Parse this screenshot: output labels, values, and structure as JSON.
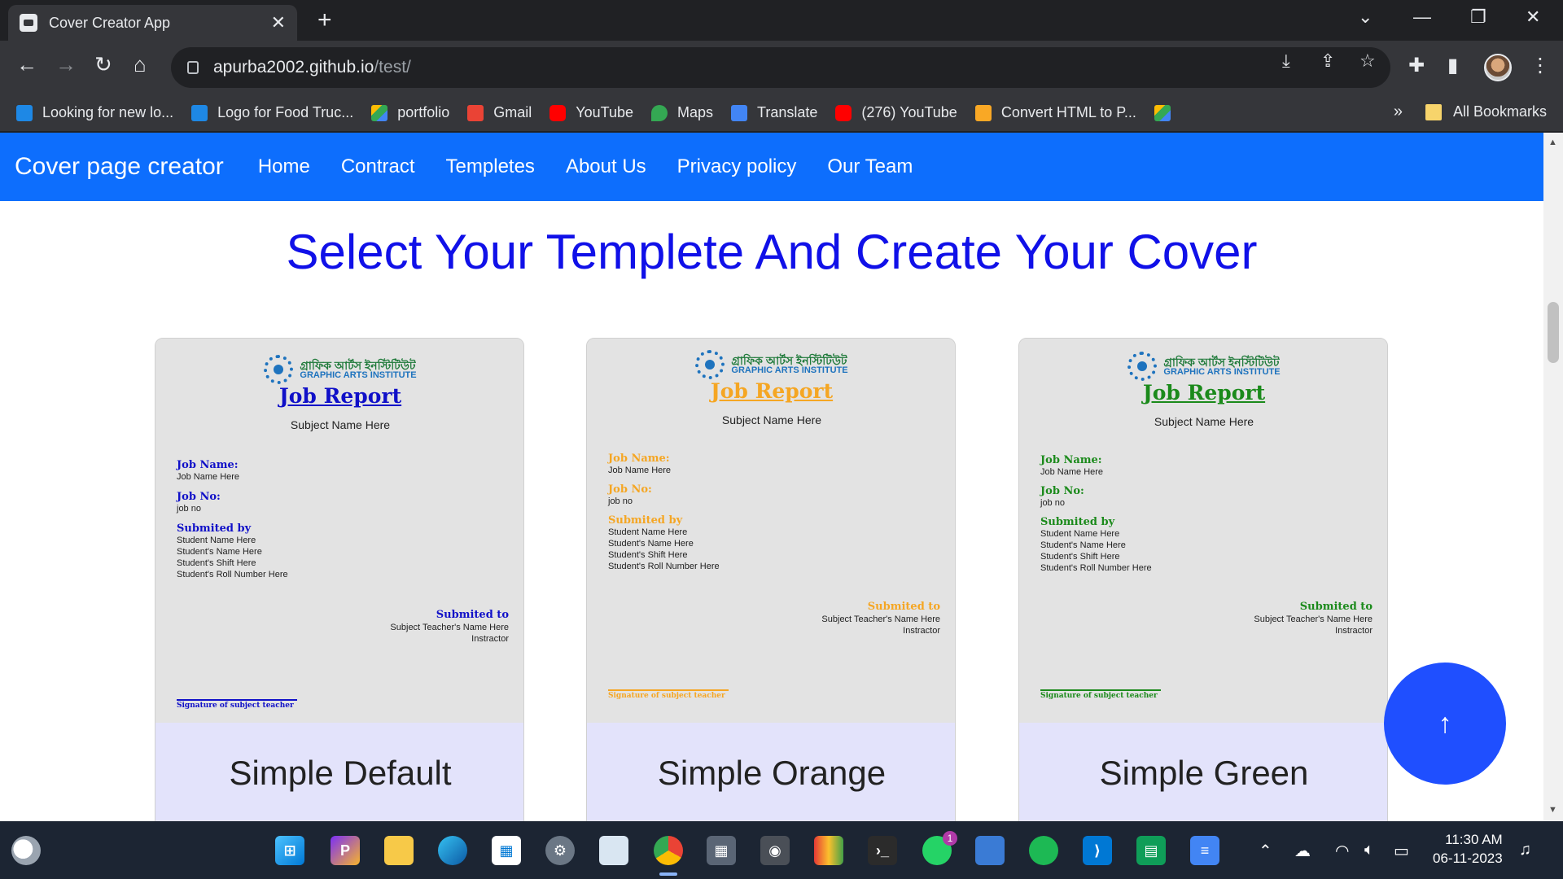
{
  "browser": {
    "tab_title": "Cover Creator App",
    "url_host": "apurba2002.github.io",
    "url_path": "/test/",
    "bookmarks": [
      {
        "label": "Looking for new lo...",
        "icon": "bird-icon",
        "color": "#1e88e5"
      },
      {
        "label": "Logo for Food Truc...",
        "icon": "bird-icon",
        "color": "#1e88e5"
      },
      {
        "label": "portfolio",
        "icon": "drive-icon",
        "color": "#34a853"
      },
      {
        "label": "Gmail",
        "icon": "gmail-icon",
        "color": "#ea4335"
      },
      {
        "label": "YouTube",
        "icon": "youtube-icon",
        "color": "#ff0000"
      },
      {
        "label": "Maps",
        "icon": "maps-icon",
        "color": "#34a853"
      },
      {
        "label": "Translate",
        "icon": "translate-icon",
        "color": "#4285f4"
      },
      {
        "label": "(276) YouTube",
        "icon": "youtube-icon",
        "color": "#ff0000"
      },
      {
        "label": "Convert HTML to P...",
        "icon": "cw-icon",
        "color": "#f9a825"
      }
    ],
    "more_bookmarks": "»",
    "all_bookmarks": "All Bookmarks"
  },
  "site": {
    "brand": "Cover page creator",
    "nav": [
      "Home",
      "Contract",
      "Templetes",
      "About Us",
      "Privacy policy",
      "Our Team"
    ],
    "headline": "Select Your Templete And Create Your Cover",
    "accent_color": "#0d6efd",
    "headline_color": "#1010e8"
  },
  "cover_common": {
    "institute_bn": "গ্রাফিক আর্টস ইনস্টিটিউট",
    "institute_en": "GRAPHIC ARTS INSTITUTE",
    "title": "Job Report",
    "subject": "Subject Name Here",
    "job_name_label": "Job Name:",
    "job_name_value": "Job Name Here",
    "job_no_label": "Job No:",
    "job_no_value": "job no",
    "submitted_by_label": "Submited by",
    "student_name": "Student Name Here",
    "student_name2": "Student's Name Here",
    "student_shift": "Student's Shift Here",
    "student_roll": "Student's Roll Number Here",
    "submitted_to_label": "Submited to",
    "teacher_name": "Subject Teacher's Name Here",
    "teacher_title": "Instractor",
    "signature": "Signature of subject teacher"
  },
  "templates": [
    {
      "name": "Simple Default",
      "color": "#1010c8"
    },
    {
      "name": "Simple Orange",
      "color": "#f5a623"
    },
    {
      "name": "Simple Green",
      "color": "#1b8a1b"
    }
  ],
  "taskbar": {
    "time": "11:30 AM",
    "date": "06-11-2023",
    "whatsapp_badge": "1"
  }
}
